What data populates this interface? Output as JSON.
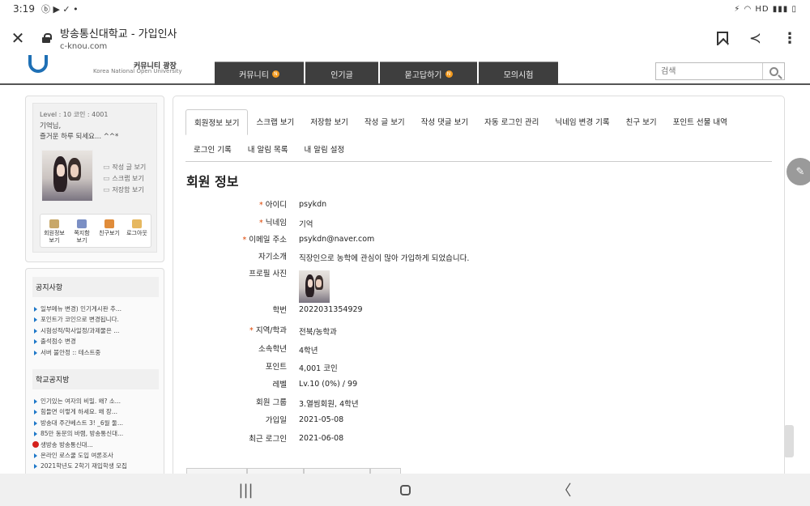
{
  "status": {
    "time": "3:19",
    "left_icons": "ⓑ ▶ ✓ •",
    "right_icons": "⚡ ◠ HD ▮▮▮ ▯"
  },
  "browser": {
    "page_title": "방송통신대학교 - 가입인사",
    "url": "c-knou.com",
    "close_glyph": "✕",
    "share_glyph": "≺",
    "menu_glyph": "⋮"
  },
  "site": {
    "logo_sub1": "커뮤니티 광장",
    "logo_sub2": "Korea National Open University",
    "nav": [
      {
        "label": "커뮤니티",
        "badge": "N",
        "width": 110
      },
      {
        "label": "인기글",
        "badge": "",
        "width": 90
      },
      {
        "label": "묻고답하기",
        "badge": "N",
        "width": 120
      },
      {
        "label": "모의시험",
        "badge": "",
        "width": 98
      }
    ],
    "search_placeholder": "검색"
  },
  "sidebar": {
    "level_line": "Level : 10  코인 : 4001",
    "greeting_1": "기억님,",
    "greeting_2": "즐거운 하루 되세요... ^^*",
    "links": [
      "작성 글 보기",
      "스크랩 보기",
      "저장함 보기"
    ],
    "buttons": [
      {
        "label1": "회원정보",
        "label2": "보기",
        "color": "#c8a86a"
      },
      {
        "label1": "쪽지함",
        "label2": "보기",
        "color": "#7b8fc4"
      },
      {
        "label1": "친구보기",
        "label2": "",
        "color": "#e08c3a"
      },
      {
        "label1": "로그아웃",
        "label2": "",
        "color": "#e6b860"
      }
    ]
  },
  "notices": {
    "title1": "공지사항",
    "items1": [
      "일부메뉴 변경) 인기게시판 추...",
      "포인트가 코인으로 변경됩니다.",
      "시험성적/학사일정/과제물은 ...",
      "출석점수 변경",
      "서버 불안정 :: 테스트중"
    ],
    "title2": "학교공지방",
    "items2": [
      "인기있는 여자의 비밀. 왜? 소...",
      "힘들면 이렇게 하세요. 왜 장...",
      "방송대 주간베스트 3! _6월 둘...",
      "85만 동문의 바램, 방송통신대...",
      "생방송 방송통신대...",
      "온라인 로스쿨 도입 여론조사",
      "2021학년도 2학기 재입학생 모집"
    ]
  },
  "tabs": {
    "row1": [
      "회원정보 보기",
      "스크랩 보기",
      "저장함 보기",
      "작성 글 보기",
      "작성 댓글 보기",
      "자동 로그인 관리",
      "닉네임 변경 기록",
      "친구 보기",
      "포인트 선물 내역"
    ],
    "row2": [
      "로그인 기록",
      "내 알림 목록",
      "내 알림 설정"
    ]
  },
  "member": {
    "section_title": "회원 정보",
    "fields": [
      {
        "label": "아이디",
        "required": true,
        "value": "psykdn"
      },
      {
        "label": "닉네임",
        "required": true,
        "value": "기억"
      },
      {
        "label": "이메일 주소",
        "required": true,
        "value": "psykdn@naver.com"
      },
      {
        "label": "자기소개",
        "required": false,
        "value": "직장인으로 농학에 관심이 많아 가입하게 되었습니다."
      },
      {
        "label": "프로필 사진",
        "required": false,
        "value": ""
      },
      {
        "label": "학번",
        "required": false,
        "value": "2022031354929"
      },
      {
        "label": "지역/학과",
        "required": true,
        "value": "전북/농학과"
      },
      {
        "label": "소속학년",
        "required": false,
        "value": "4학년"
      },
      {
        "label": "포인트",
        "required": false,
        "value": "4,001 코인"
      },
      {
        "label": "레벨",
        "required": false,
        "value": "Lv.10 (0%) / 99"
      },
      {
        "label": "회원 그룹",
        "required": false,
        "value": "3.열씸회원, 4학년"
      },
      {
        "label": "가입일",
        "required": false,
        "value": "2021-05-08"
      },
      {
        "label": "최근 로그인",
        "required": false,
        "value": "2021-06-08"
      }
    ]
  },
  "colors": {
    "nav_bg": "#3e3e3e",
    "badge": "#f39a1e",
    "required": "#dd4400",
    "bullet": "#1f78c8"
  },
  "fab_icon": "✎",
  "android_nav": {
    "recents": "|||",
    "back": "〈"
  }
}
